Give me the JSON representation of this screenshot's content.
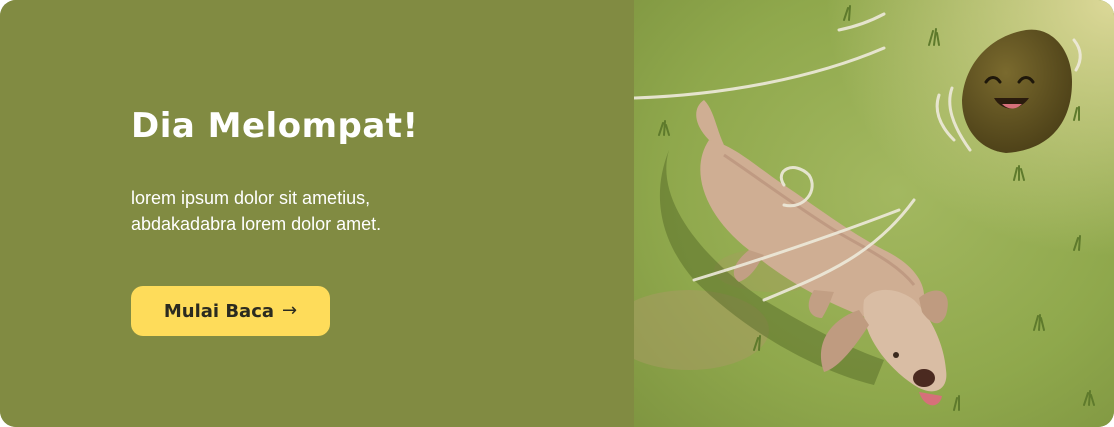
{
  "banner": {
    "title": "Dia Melompat!",
    "description": "lorem ipsum dolor sit ametius, abdakadabra lorem dolor amet.",
    "cta_label": "Mulai Baca",
    "cta_icon": "arrow-right-icon"
  },
  "colors": {
    "panel_background": "#818b42",
    "button_background": "#fedc5a",
    "text_light": "#ffffff",
    "text_dark": "#2b2b20",
    "grass": "#8fa84c",
    "dog": "#cfae93",
    "ball": "#5f5222"
  }
}
